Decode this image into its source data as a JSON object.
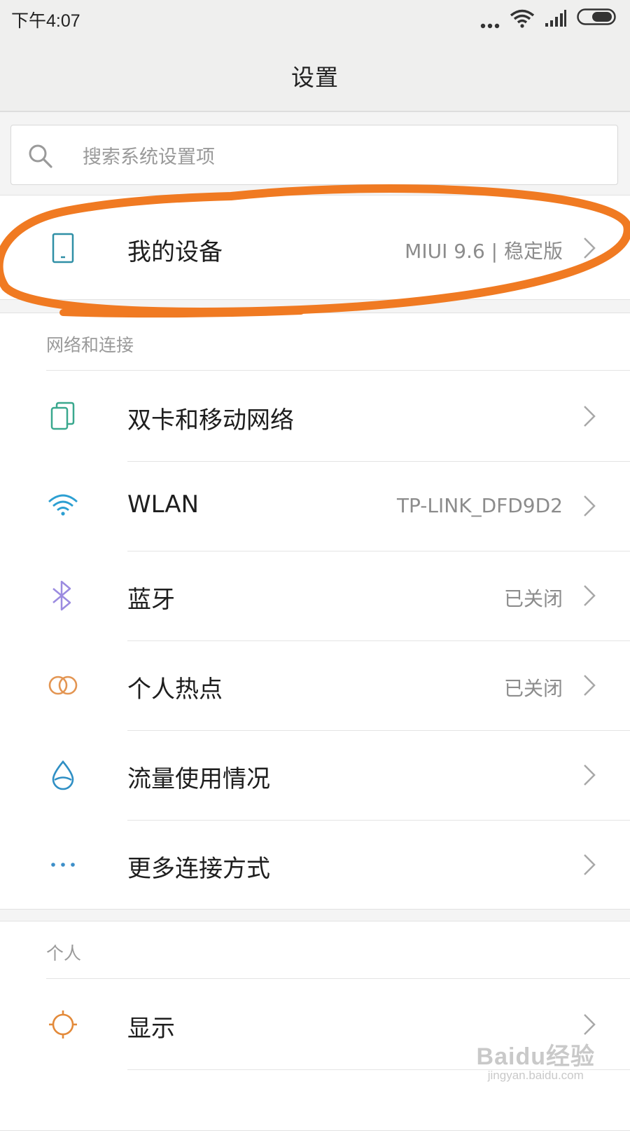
{
  "status_bar": {
    "time": "下午4:07",
    "icons": [
      "more-dots-icon",
      "wifi-icon",
      "signal-icon",
      "battery-icon"
    ]
  },
  "header": {
    "title": "设置"
  },
  "search": {
    "placeholder": "搜索系统设置项"
  },
  "device_card": {
    "label": "我的设备",
    "value": "MIUI 9.6 | 稳定版",
    "icon": "phone-icon",
    "annotation_color": "#f07a22"
  },
  "network_section": {
    "header": "网络和连接",
    "items": [
      {
        "label": "双卡和移动网络",
        "value": "",
        "icon": "dual-sim-icon",
        "icon_color": "#3aa88e"
      },
      {
        "label": "WLAN",
        "value": "TP-LINK_DFD9D2",
        "icon": "wifi-icon",
        "icon_color": "#2c9fd2"
      },
      {
        "label": "蓝牙",
        "value": "已关闭",
        "icon": "bluetooth-icon",
        "icon_color": "#9b8be0"
      },
      {
        "label": "个人热点",
        "value": "已关闭",
        "icon": "hotspot-icon",
        "icon_color": "#e39552"
      },
      {
        "label": "流量使用情况",
        "value": "",
        "icon": "data-usage-icon",
        "icon_color": "#2f8fc4"
      },
      {
        "label": "更多连接方式",
        "value": "",
        "icon": "more-connections-icon",
        "icon_color": "#3d8fc9"
      }
    ]
  },
  "personal_section": {
    "header": "个人",
    "items": [
      {
        "label": "显示",
        "value": "",
        "icon": "display-brightness-icon",
        "icon_color": "#e38a3a"
      }
    ]
  },
  "watermark": {
    "logo": "Baidu经验",
    "url": "jingyan.baidu.com"
  }
}
